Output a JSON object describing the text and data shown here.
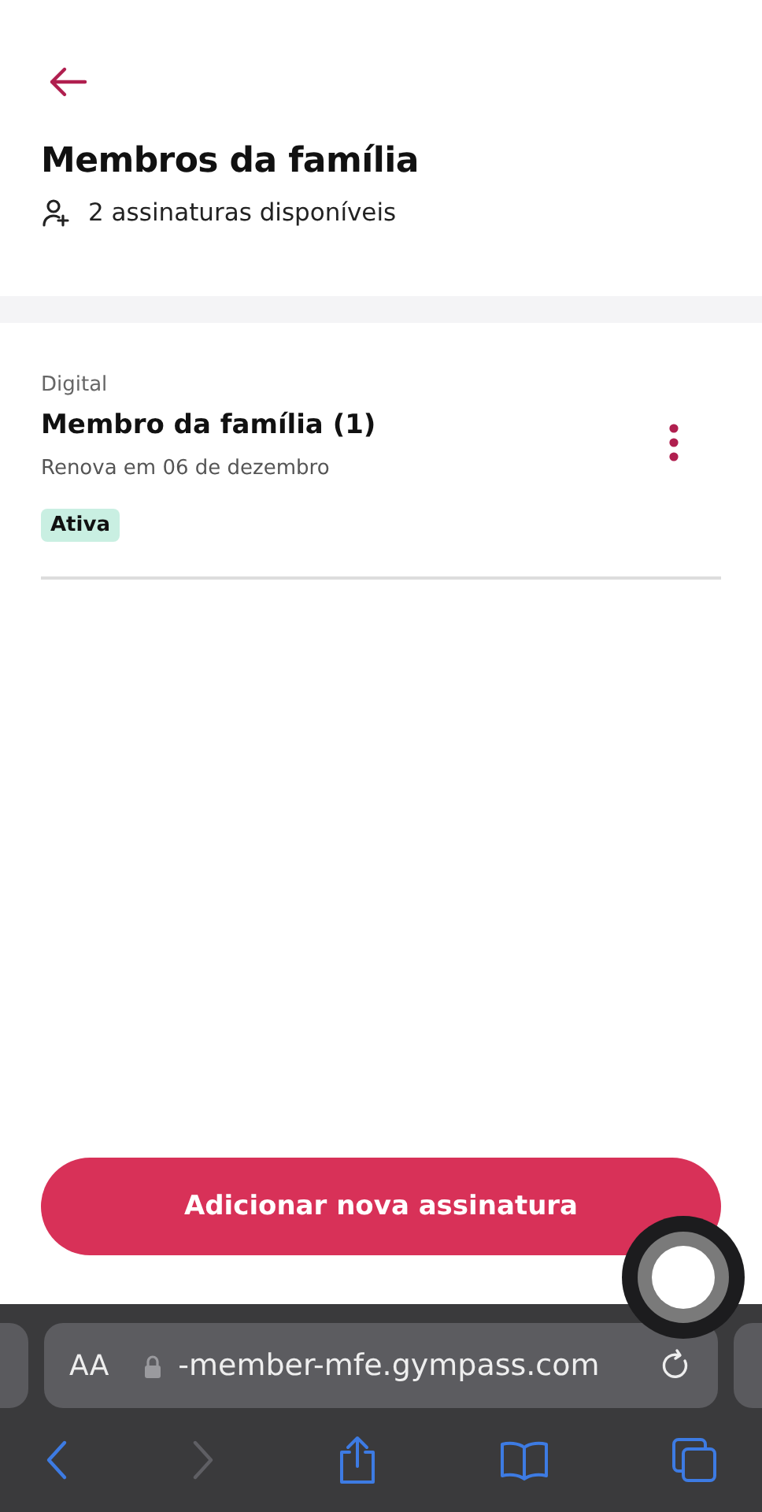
{
  "header": {
    "title": "Membros da família",
    "available": "2 assinaturas disponíveis"
  },
  "subscriptions": [
    {
      "category": "Digital",
      "name": "Membro da família (1)",
      "renewal": "Renova em 06 de dezembro",
      "status": "Ativa"
    }
  ],
  "primary_button": "Adicionar nova assinatura",
  "browser": {
    "text_size": "AA",
    "url": "-member-mfe.gympass.com",
    "toolbar": [
      {
        "kind": "back",
        "disabled": false
      },
      {
        "kind": "forward",
        "disabled": true
      },
      {
        "kind": "share",
        "disabled": false
      },
      {
        "kind": "bookmarks",
        "disabled": false
      },
      {
        "kind": "tabs",
        "disabled": false
      }
    ]
  }
}
